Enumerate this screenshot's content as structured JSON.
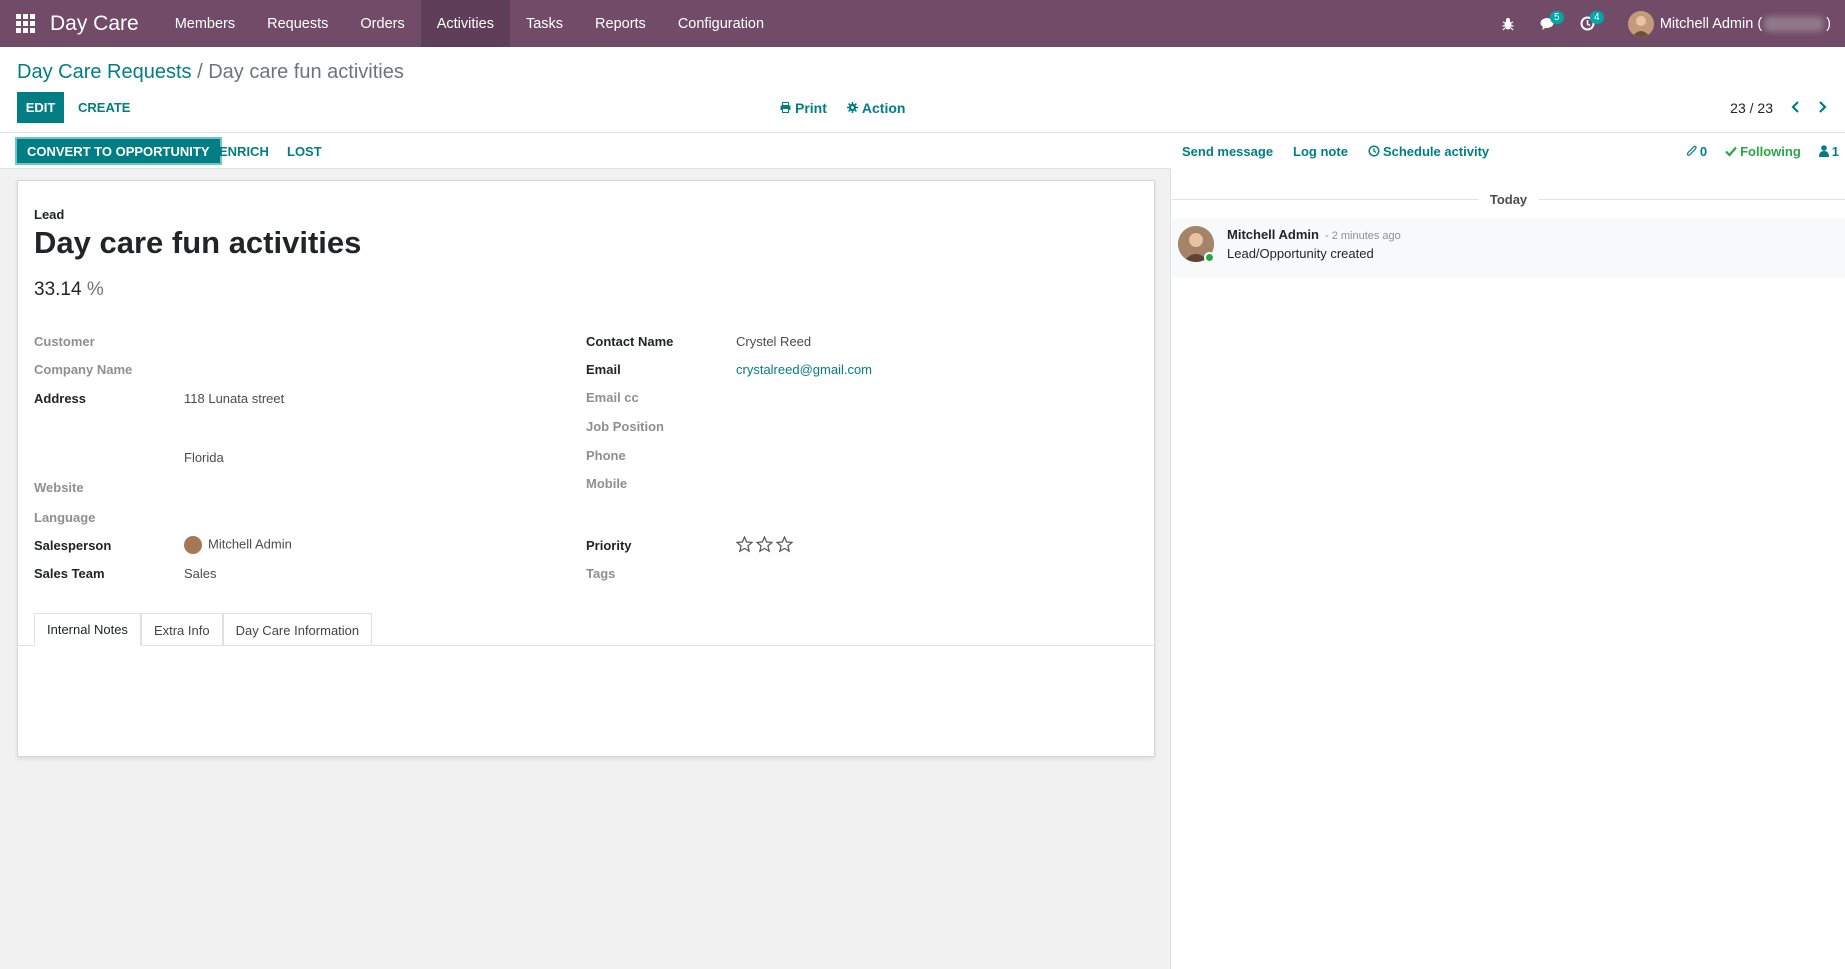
{
  "navbar": {
    "brand": "Day Care",
    "menu": [
      {
        "label": "Members"
      },
      {
        "label": "Requests"
      },
      {
        "label": "Orders"
      },
      {
        "label": "Activities"
      },
      {
        "label": "Tasks"
      },
      {
        "label": "Reports"
      },
      {
        "label": "Configuration"
      }
    ],
    "active_menu": "Activities",
    "messages_count": "5",
    "activities_count": "4",
    "user_name": "Mitchell Admin (",
    "user_name_suffix": ")",
    "accent": "#714b67"
  },
  "breadcrumb": {
    "parent": "Day Care Requests",
    "separator": " / ",
    "current": "Day care fun activities"
  },
  "toolbar": {
    "edit_label": "EDIT",
    "create_label": "CREATE",
    "print_label": "Print",
    "action_label": "Action"
  },
  "pager": {
    "value": "23 / 23"
  },
  "statusbar": {
    "convert_label": "CONVERT TO OPPORTUNITY",
    "enrich_label": "ENRICH",
    "lost_label": "LOST"
  },
  "form": {
    "type_label": "Lead",
    "title": "Day care fun activities",
    "probability": "33.14",
    "probability_unit": "%",
    "left_fields": {
      "customer_label": "Customer",
      "company_label": "Company Name",
      "address_label": "Address",
      "address_street": "118 Lunata street",
      "address_state": "Florida",
      "website_label": "Website",
      "language_label": "Language",
      "salesperson_label": "Salesperson",
      "salesperson_value": "Mitchell Admin",
      "sales_team_label": "Sales Team",
      "sales_team_value": "Sales"
    },
    "right_fields": {
      "contact_label": "Contact Name",
      "contact_value": "Crystel Reed",
      "email_label": "Email",
      "email_value": "crystalreed@gmail.com",
      "email_cc_label": "Email cc",
      "job_label": "Job Position",
      "phone_label": "Phone",
      "mobile_label": "Mobile",
      "priority_label": "Priority",
      "priority_stars": 0,
      "priority_max": 3,
      "tags_label": "Tags"
    },
    "tabs": [
      {
        "label": "Internal Notes"
      },
      {
        "label": "Extra Info"
      },
      {
        "label": "Day Care Information"
      }
    ],
    "active_tab": "Internal Notes"
  },
  "chatter": {
    "send_message_label": "Send message",
    "log_note_label": "Log note",
    "schedule_label": "Schedule activity",
    "attachments_count": "0",
    "following_label": "Following",
    "followers_count": "1",
    "date_separator": "Today",
    "messages": [
      {
        "author": "Mitchell Admin",
        "date": "- 2 minutes ago",
        "body": "Lead/Opportunity created"
      }
    ]
  }
}
